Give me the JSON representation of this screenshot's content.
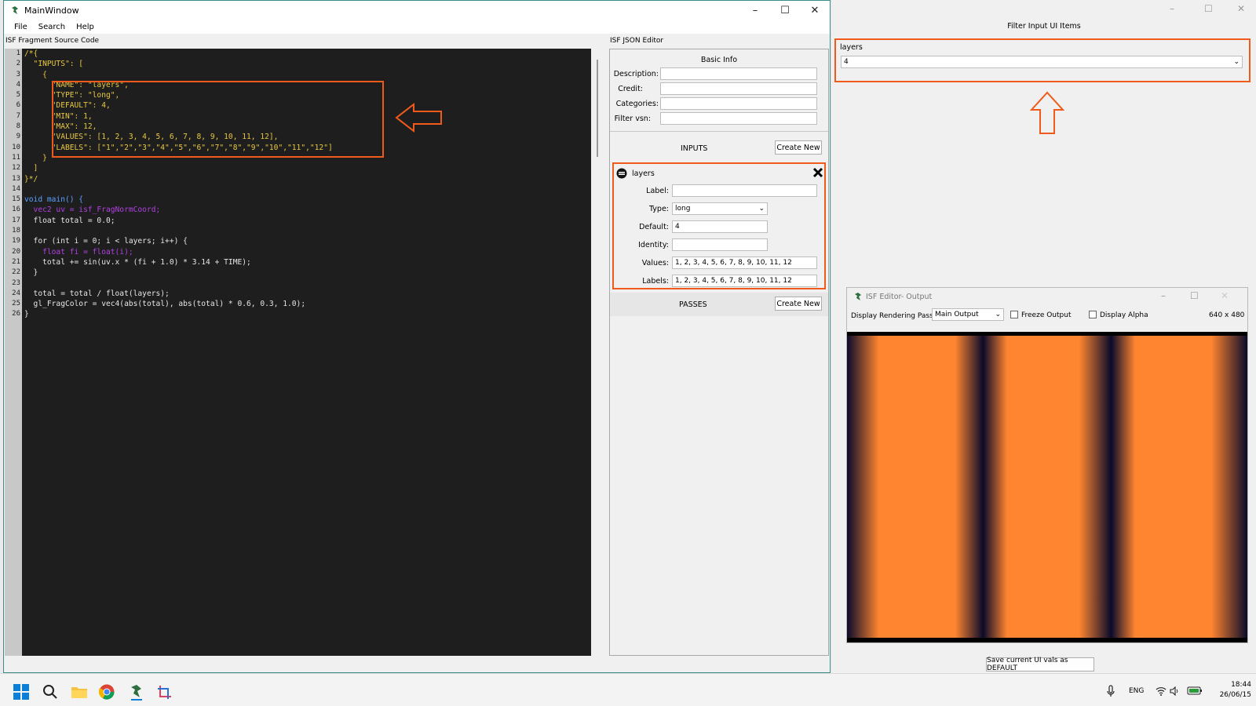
{
  "main_window": {
    "title": "MainWindow",
    "menu": [
      "File",
      "Search",
      "Help"
    ],
    "source_label": "ISF Fragment Source Code",
    "json_label": "ISF JSON Editor"
  },
  "code": {
    "line_numbers": [
      "1",
      "2",
      "3",
      "4",
      "5",
      "6",
      "7",
      "8",
      "9",
      "10",
      "11",
      "12",
      "13",
      "14",
      "15",
      "16",
      "17",
      "18",
      "19",
      "20",
      "21",
      "22",
      "23",
      "24",
      "25",
      "26"
    ],
    "lines": [
      "/*{",
      "  \"INPUTS\": [",
      "    {",
      "      \"NAME\": \"layers\",",
      "      \"TYPE\": \"long\",",
      "      \"DEFAULT\": 4,",
      "      \"MIN\": 1,",
      "      \"MAX\": 12,",
      "      \"VALUES\": [1, 2, 3, 4, 5, 6, 7, 8, 9, 10, 11, 12],",
      "      \"LABELS\": [\"1\",\"2\",\"3\",\"4\",\"5\",\"6\",\"7\",\"8\",\"9\",\"10\",\"11\",\"12\"]",
      "    }",
      "  ]",
      "}*/",
      "",
      "void main() {",
      "  vec2 uv = isf_FragNormCoord;",
      "  float total = 0.0;",
      "",
      "  for (int i = 0; i < layers; i++) {",
      "    float fi = float(i);",
      "    total += sin(uv.x * (fi + 1.0) * 3.14 + TIME);",
      "  }",
      "",
      "  total = total / float(layers);",
      "  gl_FragColor = vec4(abs(total), abs(total) * 0.6, 0.3, 1.0);",
      "}"
    ]
  },
  "basic_info": {
    "title": "Basic Info",
    "description_label": "Description:",
    "credit_label": "Credit:",
    "categories_label": "Categories:",
    "filter_vsn_label": "Filter vsn:"
  },
  "inputs_section": {
    "title": "INPUTS",
    "create_label": "Create New"
  },
  "input_item": {
    "name": "layers",
    "label_label": "Label:",
    "label_value": "",
    "type_label": "Type:",
    "type_value": "long",
    "default_label": "Default:",
    "default_value": "4",
    "identity_label": "Identity:",
    "identity_value": "",
    "values_label": "Values:",
    "values_value": "1, 2, 3, 4, 5, 6, 7, 8, 9, 10, 11, 12",
    "labels_label": "Labels:",
    "labels_value": "1, 2, 3, 4, 5, 6, 7, 8, 9, 10, 11, 12"
  },
  "passes_section": {
    "title": "PASSES",
    "create_label": "Create New"
  },
  "filter_window": {
    "title": "Filter Input UI Items",
    "input_name": "layers",
    "input_value": "4",
    "save_label": "Save current UI vals as DEFAULT"
  },
  "output_window": {
    "title": "ISF Editor- Output",
    "pass_label": "Display Rendering Pass:",
    "pass_value": "Main Output",
    "freeze_label": "Freeze Output",
    "alpha_label": "Display Alpha",
    "resolution": "640 x 480"
  },
  "taskbar": {
    "language": "ENG",
    "time": "18:44",
    "date": "26/06/15"
  },
  "colors": {
    "annotation": "#f05a1a",
    "render_orange": "#ff8530",
    "render_dark": "#0a0a2a"
  }
}
